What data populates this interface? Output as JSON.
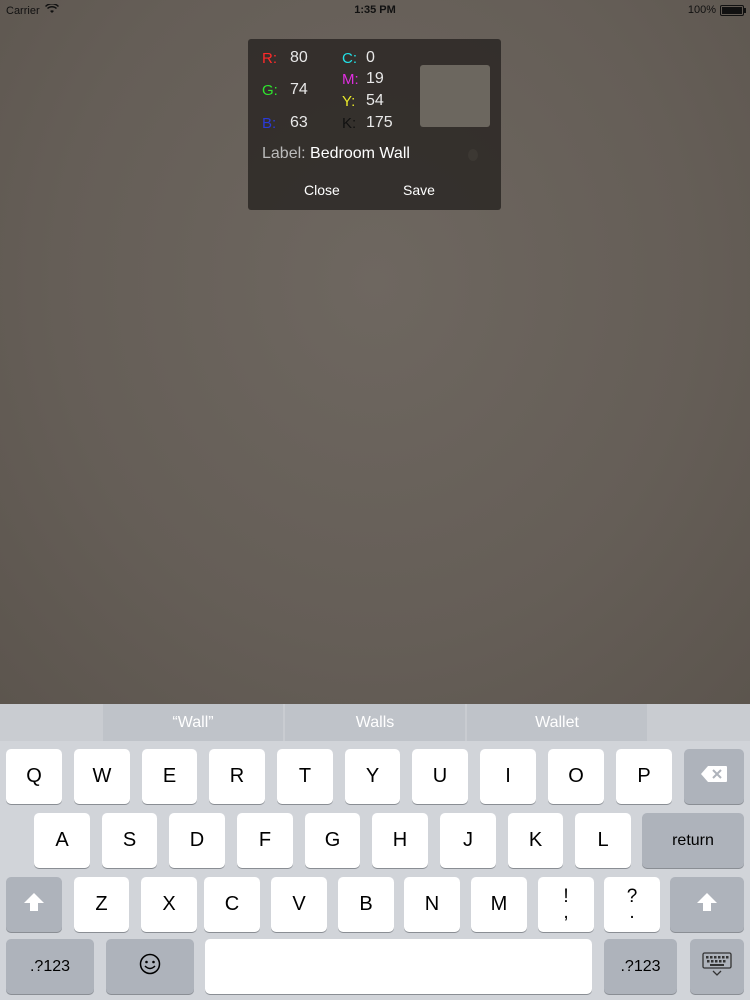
{
  "status_bar": {
    "carrier": "Carrier",
    "time": "1:35 PM",
    "battery": "100%"
  },
  "popup": {
    "rgb": [
      {
        "label": "R:",
        "value": "80",
        "color": "#ff2a2a"
      },
      {
        "label": "G:",
        "value": "74",
        "color": "#2ee52e"
      },
      {
        "label": "B:",
        "value": "63",
        "color": "#2a3ad8"
      }
    ],
    "cmyk": [
      {
        "label": "C:",
        "value": "0",
        "color": "#22e0e6"
      },
      {
        "label": "M:",
        "value": "19",
        "color": "#e02ee0"
      },
      {
        "label": "Y:",
        "value": "54",
        "color": "#e8e82a"
      },
      {
        "label": "K:",
        "value": "175",
        "color": "#111111"
      }
    ],
    "label_prefix": "Label:",
    "label_value": "Bedroom Wall",
    "close": "Close",
    "save": "Save"
  },
  "keyboard": {
    "suggestions": [
      "“Wall”",
      "Walls",
      "Wallet"
    ],
    "row1": [
      "Q",
      "W",
      "E",
      "R",
      "T",
      "Y",
      "U",
      "I",
      "O",
      "P"
    ],
    "row2": [
      "A",
      "S",
      "D",
      "F",
      "G",
      "H",
      "J",
      "K",
      "L"
    ],
    "row3": [
      "Z",
      "X",
      "C",
      "V",
      "B",
      "N",
      "M"
    ],
    "punct1": [
      "!",
      ","
    ],
    "punct2": [
      "?",
      "."
    ],
    "return": "return",
    "numbers": ".?123",
    "numbers_right": ".?123"
  }
}
